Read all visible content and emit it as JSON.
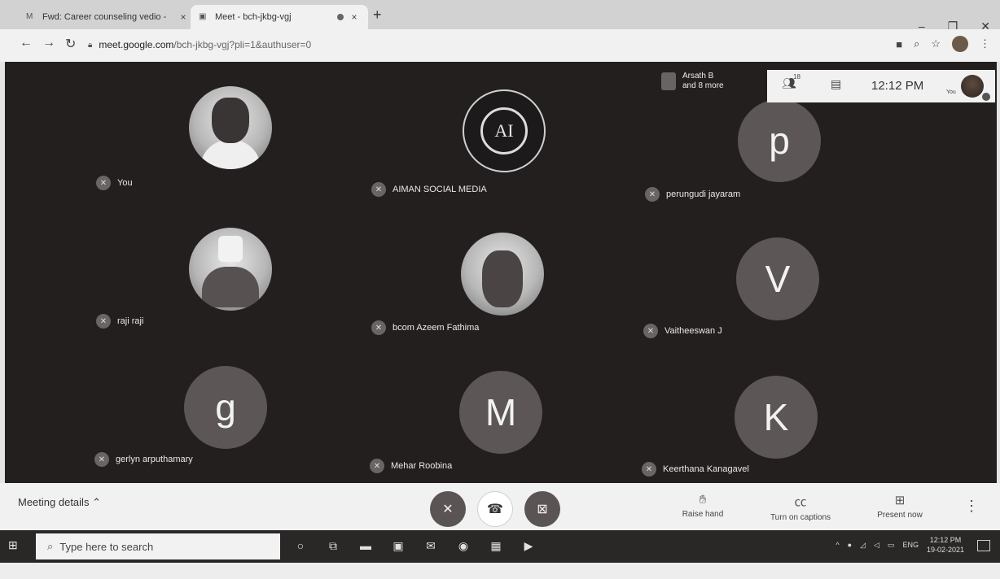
{
  "browser": {
    "tabs": [
      {
        "title": "Fwd: Career counseling vedio - ",
        "icon": "gmail-icon",
        "active": false
      },
      {
        "title": "Meet - bch-jkbg-vgj",
        "icon": "meet-icon",
        "active": true
      }
    ],
    "url_host": "meet.google.com",
    "url_path": "/bch-jkbg-vgj?pli=1&authuser=0"
  },
  "meeting": {
    "people_count": "18",
    "time": "12:12 PM",
    "you_label": "You",
    "more_people": {
      "name": "Arsath B",
      "more": "and 8 more"
    },
    "participants": [
      {
        "name": "You",
        "avatar": "photo-you"
      },
      {
        "name": "AIMAN SOCIAL MEDIA",
        "avatar": "logo",
        "logo_text": "AI"
      },
      {
        "name": "perungudi jayaram",
        "avatar": "letter",
        "letter": "p"
      },
      {
        "name": "raji raji",
        "avatar": "photo-marshmello"
      },
      {
        "name": "bcom Azeem Fathima",
        "avatar": "photo-person"
      },
      {
        "name": "Vaitheeswan J",
        "avatar": "letter",
        "letter": "V"
      },
      {
        "name": "gerlyn arputhamary",
        "avatar": "letter",
        "letter": "g"
      },
      {
        "name": "Mehar Roobina",
        "avatar": "letter",
        "letter": "M"
      },
      {
        "name": "Keerthana Kanagavel",
        "avatar": "letter",
        "letter": "K"
      }
    ]
  },
  "controls": {
    "meeting_details": "Meeting details",
    "raise_hand": "Raise hand",
    "captions": "Turn on captions",
    "present": "Present now"
  },
  "taskbar": {
    "search_placeholder": "Type here to search",
    "lang": "ENG",
    "time": "12:12 PM",
    "date": "19-02-2021"
  }
}
